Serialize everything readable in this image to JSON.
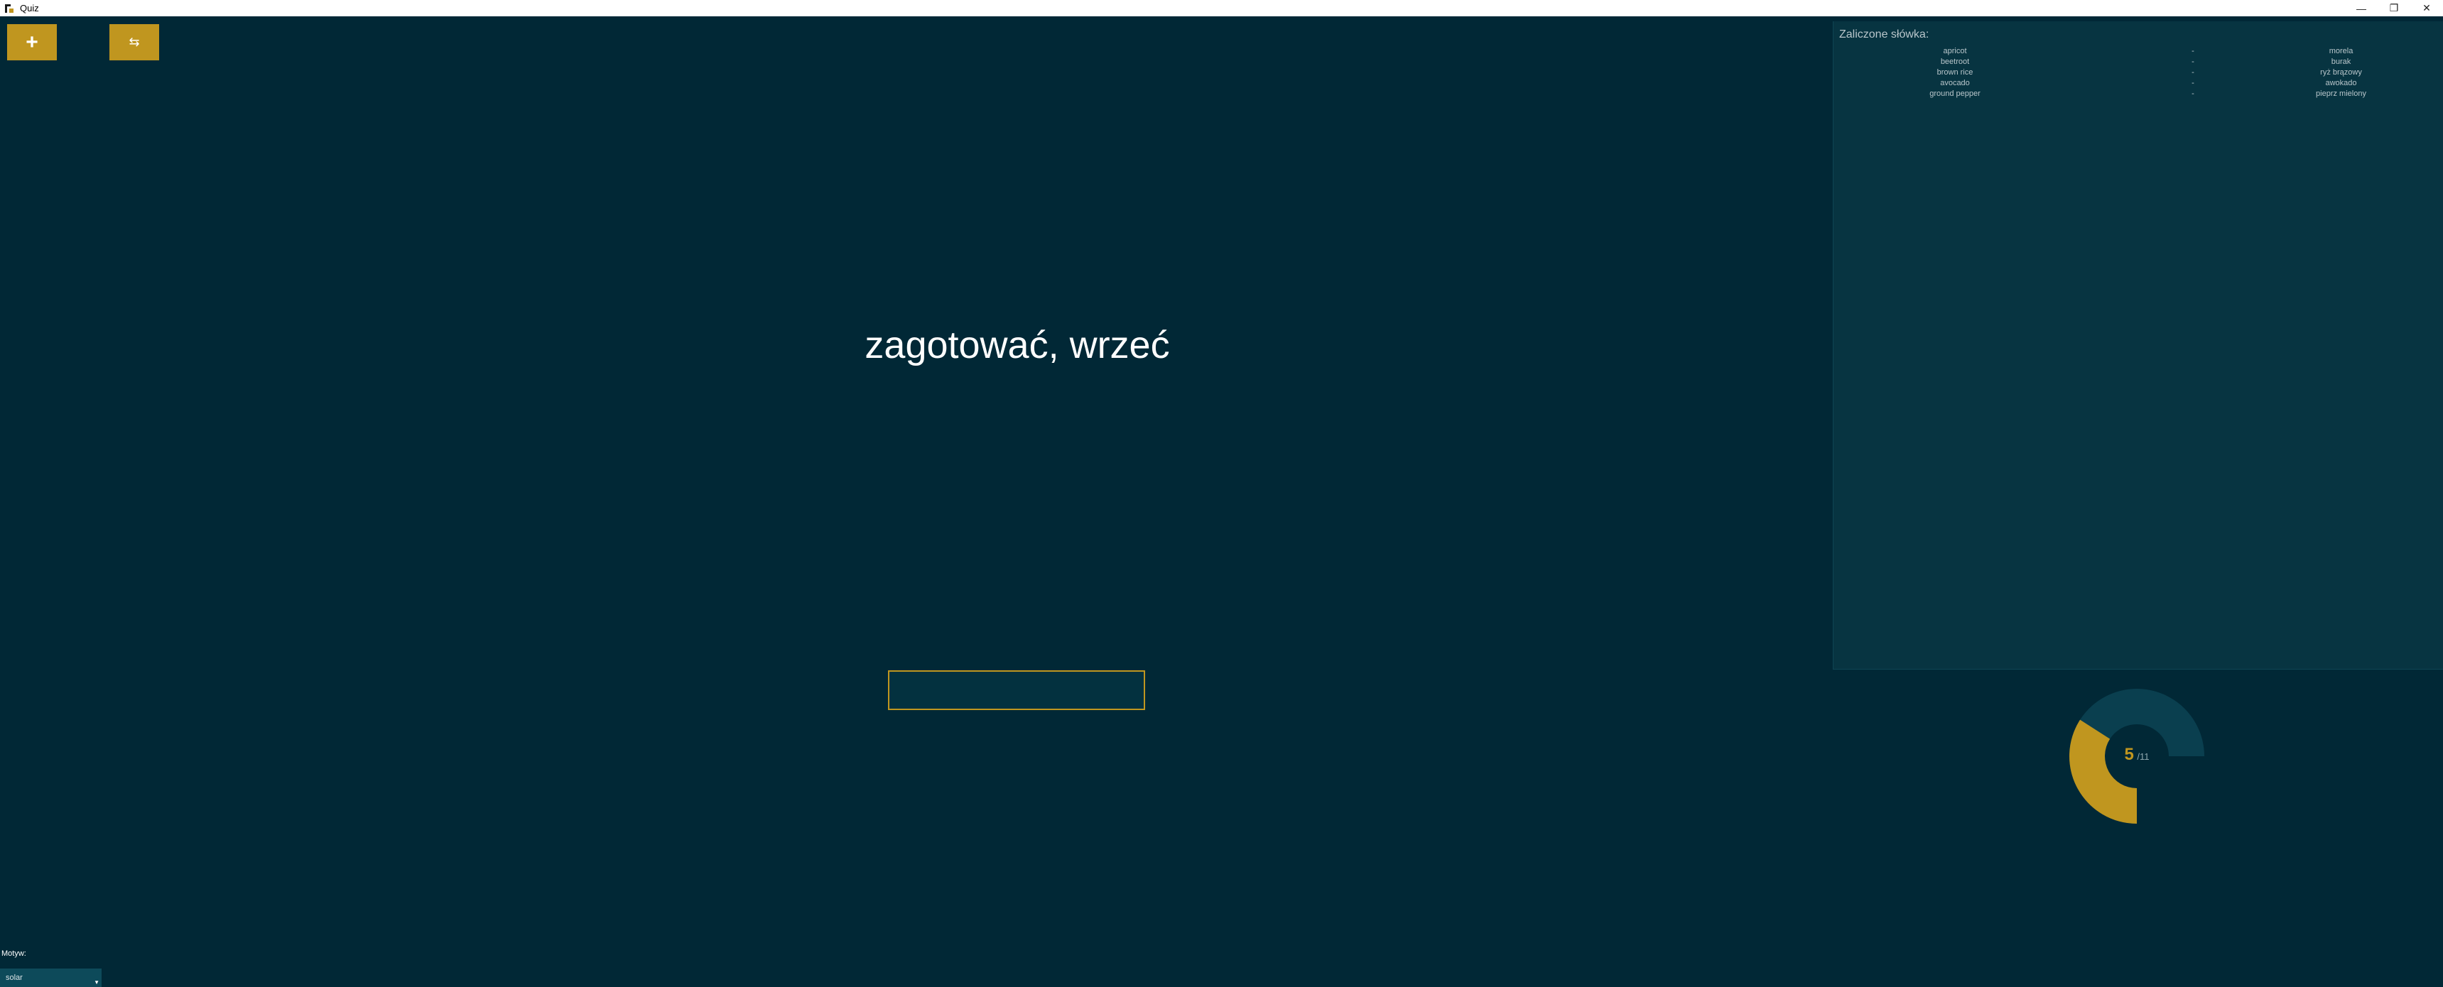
{
  "window": {
    "title": "Quiz",
    "minimize_glyph": "—",
    "maximize_glyph": "❐",
    "close_glyph": "✕"
  },
  "toolbar": {
    "add_glyph": "+",
    "swap_glyph": "⇆"
  },
  "quiz": {
    "question": "zagotować, wrzeć",
    "answer_value": ""
  },
  "completed": {
    "title": "Zaliczone słówka:",
    "words": [
      {
        "en": "apricot",
        "sep": "-",
        "pl": "morela"
      },
      {
        "en": "beetroot",
        "sep": "-",
        "pl": "burak"
      },
      {
        "en": "brown rice",
        "sep": "-",
        "pl": "ryż brązowy"
      },
      {
        "en": "avocado",
        "sep": "-",
        "pl": "awokado"
      },
      {
        "en": "ground pepper",
        "sep": "-",
        "pl": "pieprz mielony"
      }
    ]
  },
  "progress": {
    "done": 5,
    "total": 11,
    "done_label": "5",
    "total_label": "/11"
  },
  "theme": {
    "label": "Motyw:",
    "selected": "solar"
  },
  "colors": {
    "background": "#012836",
    "accent": "#c0961f",
    "panel": "#073441",
    "donut_track": "#0a3f4f"
  }
}
